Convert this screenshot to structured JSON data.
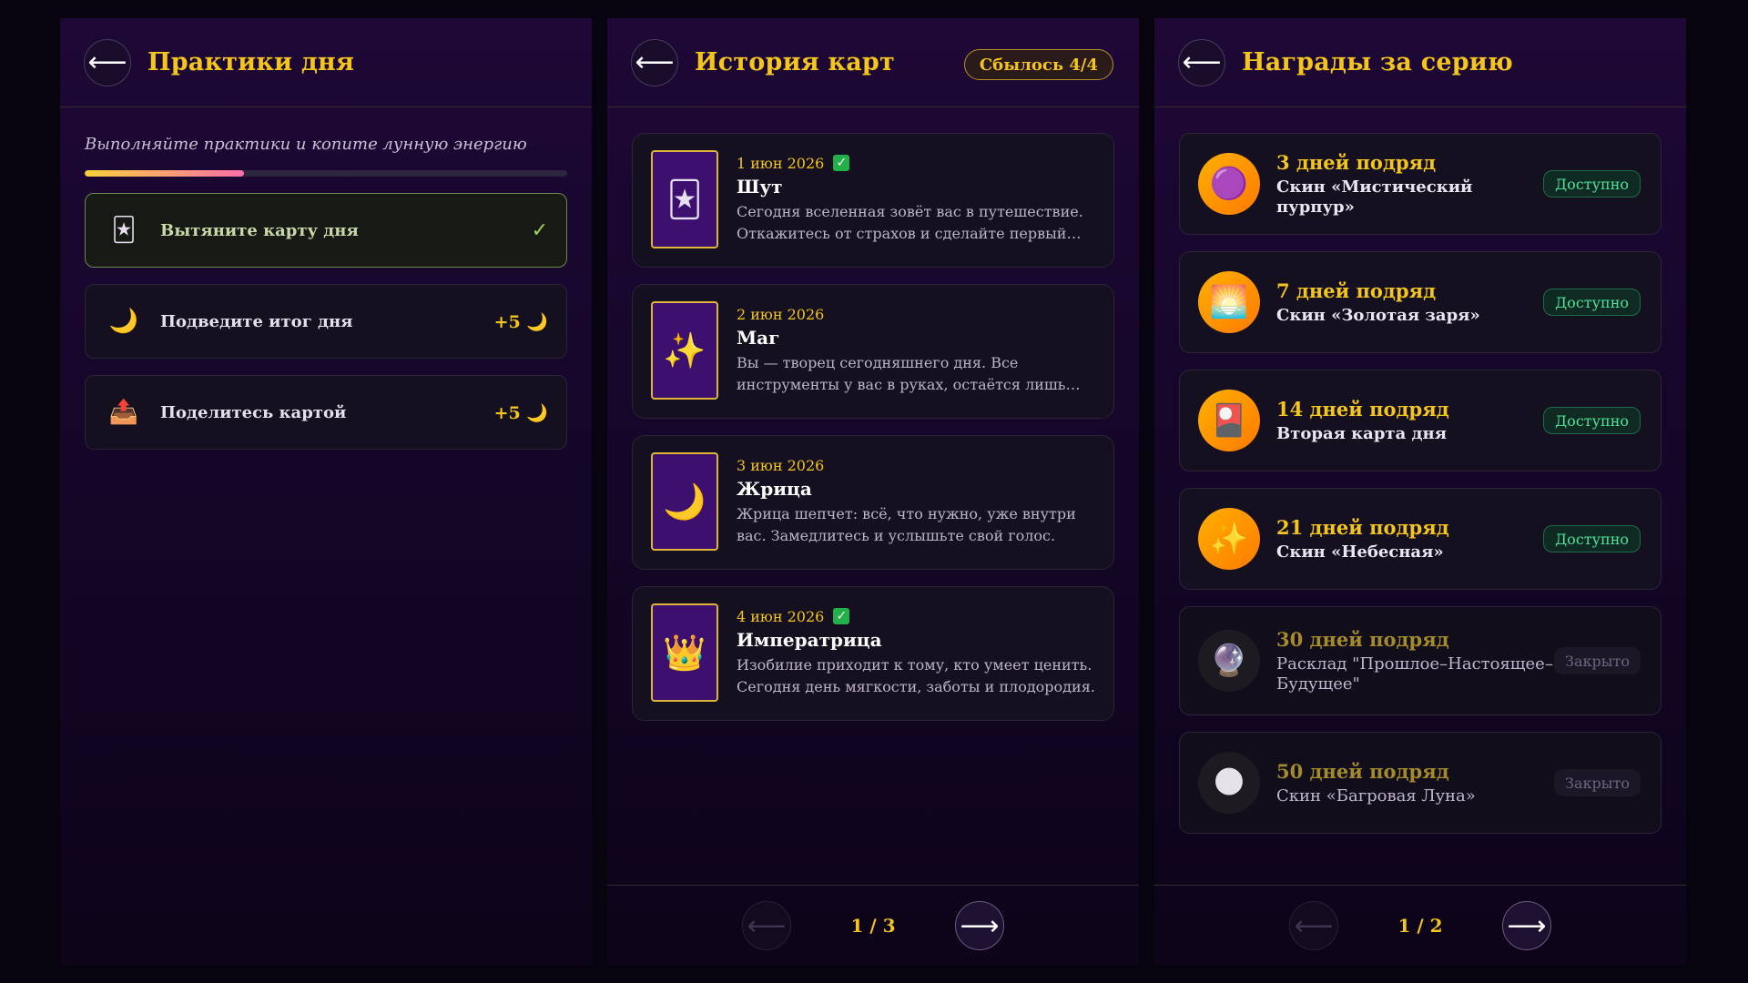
{
  "panel1": {
    "title": "Практики дня",
    "subtitle": "Выполняйте практики и копите лунную энергию",
    "progress": 0.33,
    "tasks": [
      {
        "icon": "🃏",
        "label": "Вытяните карту дня",
        "status": "✓"
      },
      {
        "icon": "🌙",
        "label": "Подведите итог дня",
        "reward": "+5 🌙"
      },
      {
        "icon": "📤",
        "label": "Поделитесь картой",
        "reward": "+5 🌙"
      }
    ]
  },
  "panel2": {
    "title": "История карт",
    "badge": "Сбылось 4/4",
    "cards": [
      {
        "icon": "🃏",
        "date": "1 июн 2026",
        "checked": true,
        "name": "Шут",
        "text": "Сегодня вселенная зовёт вас в путешествие. Откажитесь от страхов и сделайте первый шаг — смело и открыто."
      },
      {
        "icon": "✨",
        "date": "2 июн 2026",
        "checked": false,
        "name": "Маг",
        "text": "Вы — творец сегодняшнего дня. Все инструменты у вас в руках, остаётся лишь сосредоточиться и действовать."
      },
      {
        "icon": "🌙",
        "date": "3 июн 2026",
        "checked": false,
        "name": "Жрица",
        "text": "Жрица шепчет: всё, что нужно, уже внутри вас. Замедлитесь и услышьте свой голос."
      },
      {
        "icon": "👑",
        "date": "4 июн 2026",
        "checked": true,
        "name": "Императрица",
        "text": "Изобилие приходит к тому, кто умеет ценить. Сегодня день мягкости, заботы и плодородия."
      }
    ],
    "pagination": {
      "label": "1 / 3",
      "prev": "⟵",
      "next": "⟶"
    }
  },
  "panel3": {
    "title": "Награды за серию",
    "rewards": [
      {
        "icon": "🟣",
        "title": "3 дней подряд",
        "desc": "Скин «Мистический пурпур»",
        "status": "Доступно",
        "locked": false
      },
      {
        "icon": "🌅",
        "title": "7 дней подряд",
        "desc": "Скин «Золотая заря»",
        "status": "Доступно",
        "locked": false
      },
      {
        "icon": "🎴",
        "title": "14 дней подряд",
        "desc": "Вторая карта дня",
        "status": "Доступно",
        "locked": false
      },
      {
        "icon": "✨",
        "title": "21 дней подряд",
        "desc": "Скин «Небесная»",
        "status": "Доступно",
        "locked": false
      },
      {
        "icon": "🔮",
        "title": "30 дней подряд",
        "desc": "Расклад \"Прошлое–Настоящее–Будущее\"",
        "status": "Закрыто",
        "locked": true
      },
      {
        "icon": "🌑",
        "title": "50 дней подряд",
        "desc": "Скин «Багровая Луна»",
        "status": "Закрыто",
        "locked": true
      }
    ],
    "pagination": {
      "label": "1 / 2",
      "prev": "⟵",
      "next": "⟶"
    }
  },
  "back_label": "⟵",
  "colors": {
    "accent": "#f3c51d",
    "available": "#4ee39a",
    "panel": "#1e0836"
  }
}
